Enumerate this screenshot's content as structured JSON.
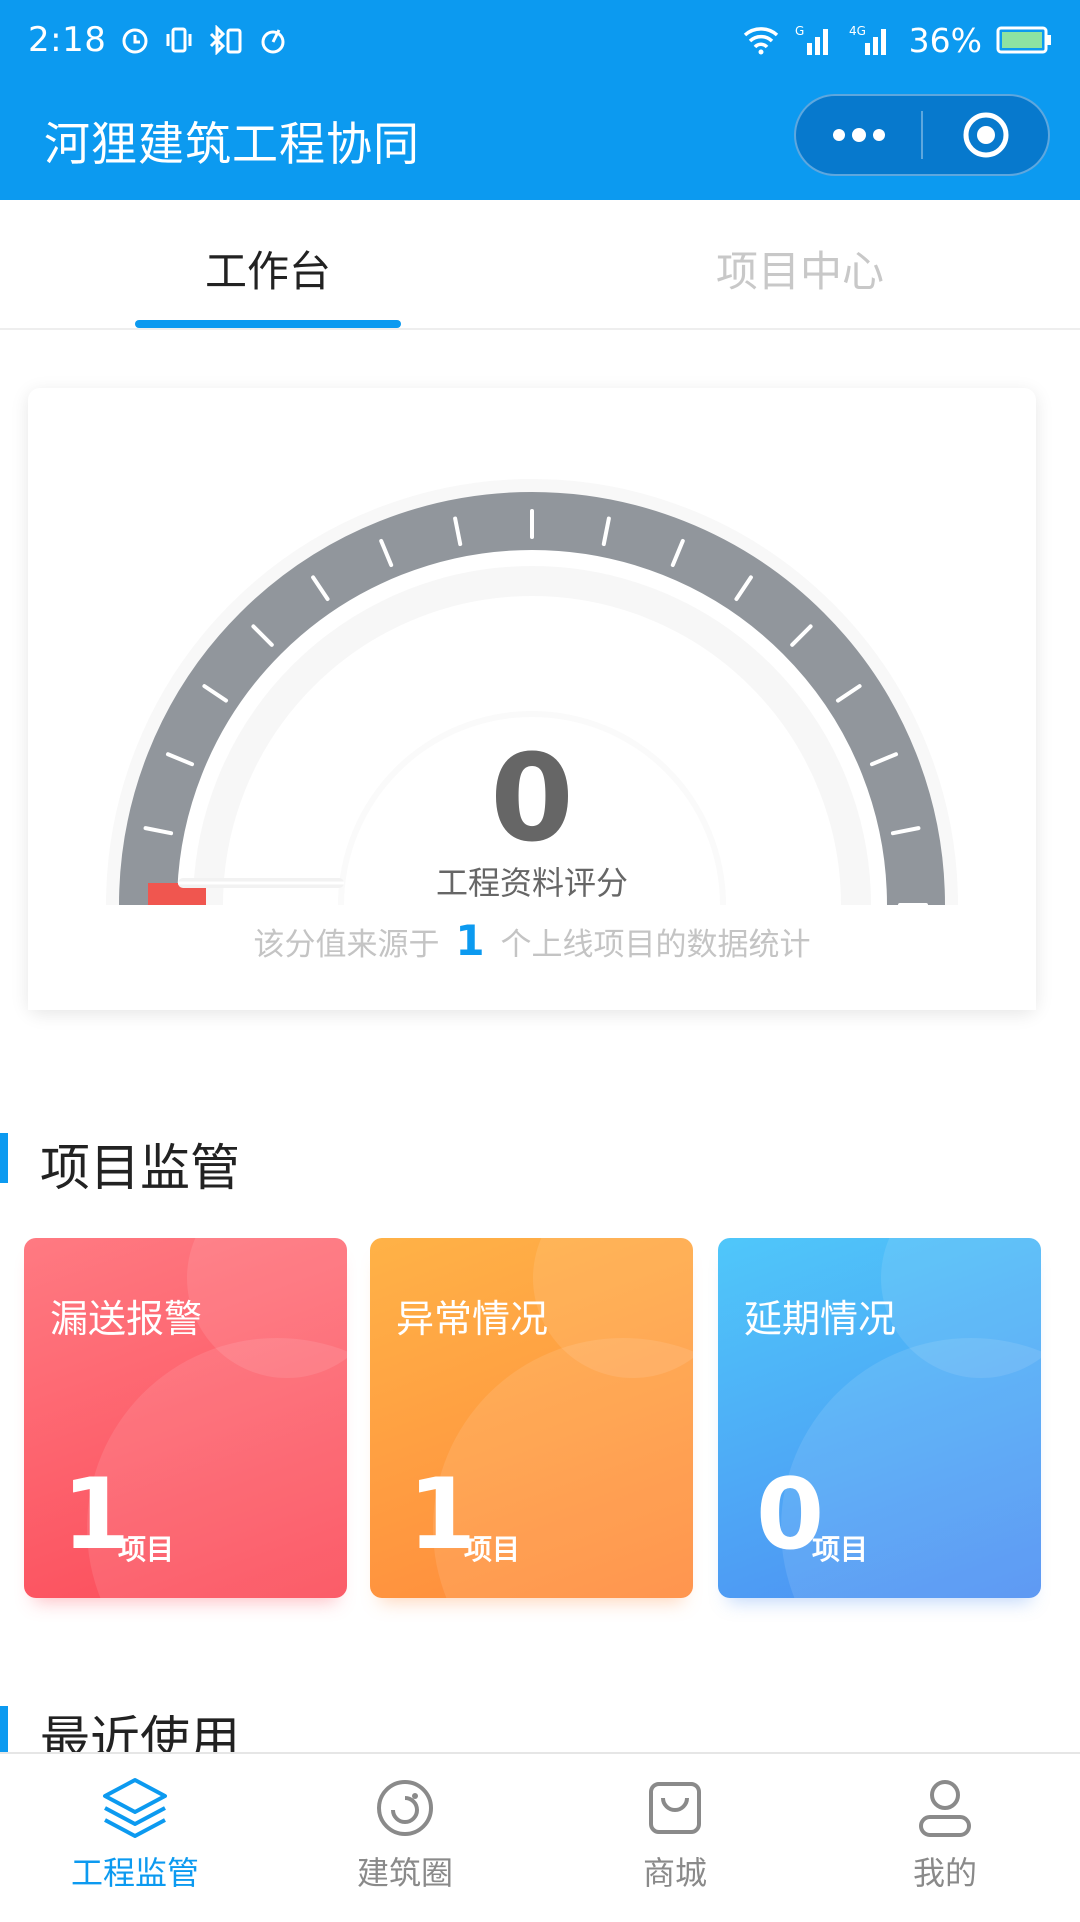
{
  "status_bar": {
    "time": "2:18",
    "battery": "36%",
    "signal_labels": [
      "G",
      "4G"
    ]
  },
  "header": {
    "title": "河狸建筑工程协同",
    "bg_color": "#0C9AF0"
  },
  "tabs": [
    {
      "label": "工作台",
      "active": true
    },
    {
      "label": "项目中心",
      "active": false
    }
  ],
  "score_card": {
    "value": "0",
    "label": "工程资料评分",
    "note_prefix": "该分值来源于",
    "note_count": "1",
    "note_suffix": "个上线项目的数据统计",
    "gauge_fraction": 0
  },
  "project_section": {
    "title": "项目监管",
    "cards": [
      {
        "title": "漏送报警",
        "count": "1",
        "unit": "项目",
        "color": "#FB4A58"
      },
      {
        "title": "异常情况",
        "count": "1",
        "unit": "项目",
        "color": "#FF8A3C"
      },
      {
        "title": "延期情况",
        "count": "0",
        "unit": "项目",
        "color": "#4D8EF2"
      }
    ]
  },
  "recent_section": {
    "title": "最近使用"
  },
  "tabbar": [
    {
      "label": "工程监管",
      "icon": "layers-icon",
      "active": true
    },
    {
      "label": "建筑圈",
      "icon": "circle-camera-icon",
      "active": false
    },
    {
      "label": "商城",
      "icon": "shopping-bag-icon",
      "active": false
    },
    {
      "label": "我的",
      "icon": "user-icon",
      "active": false
    }
  ]
}
